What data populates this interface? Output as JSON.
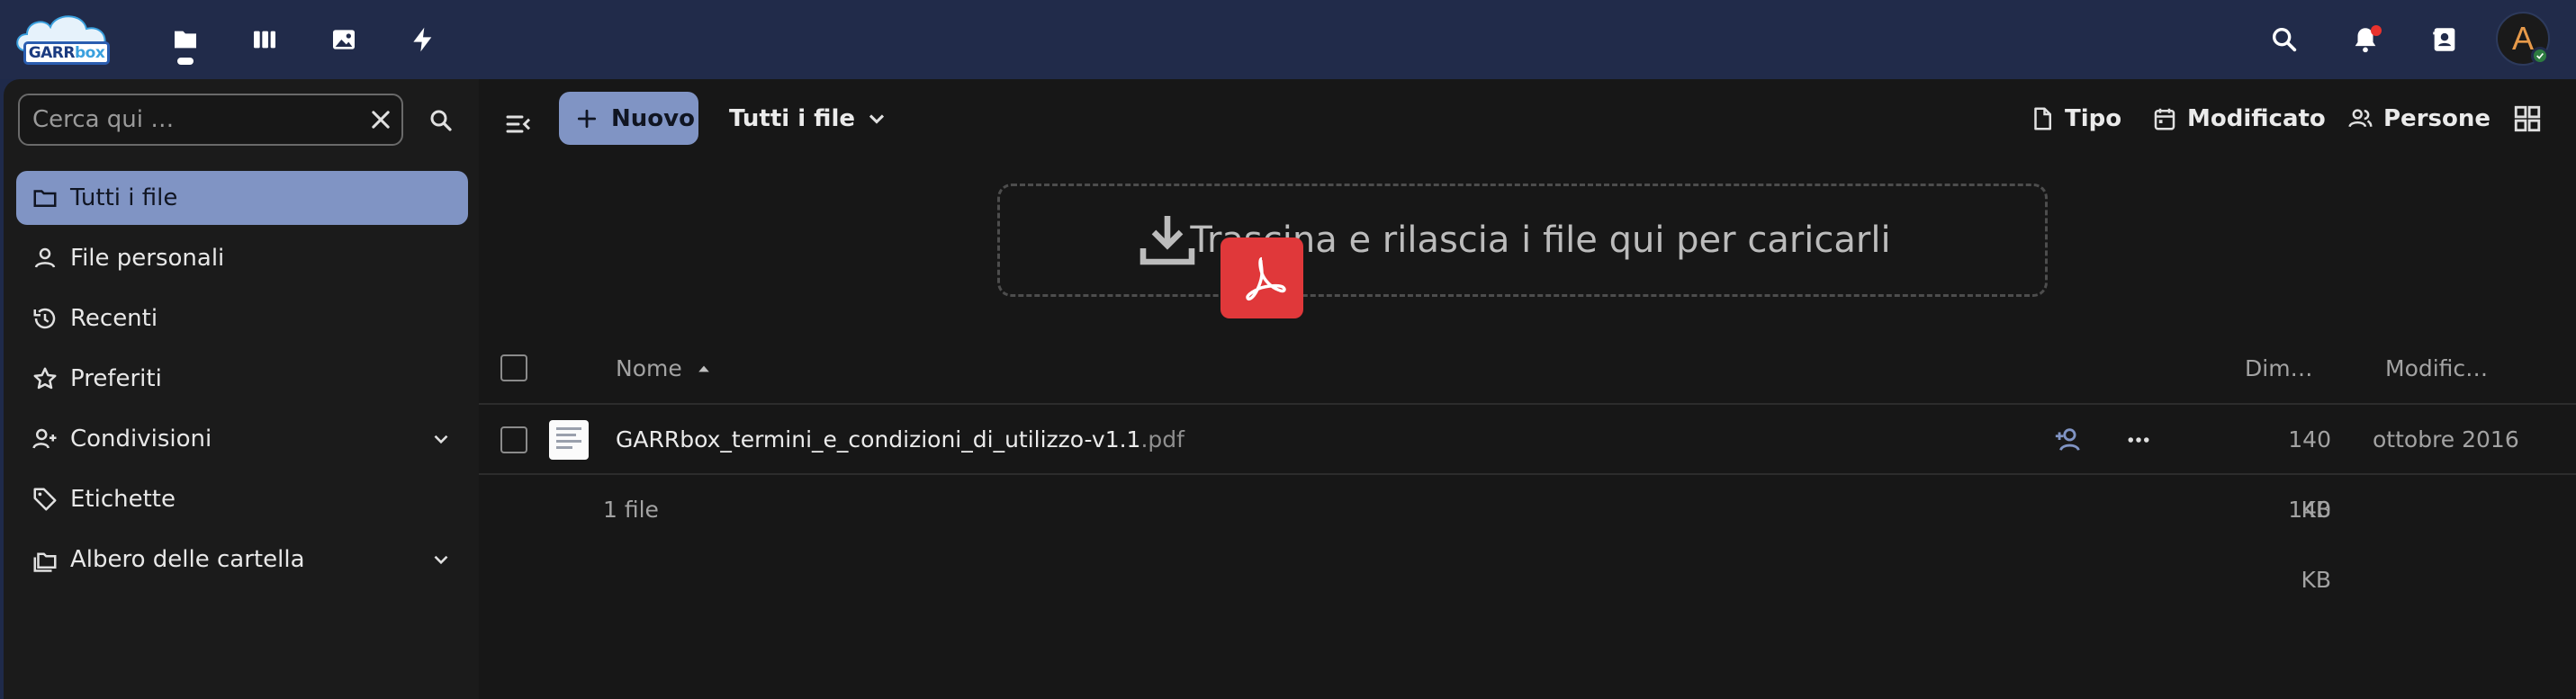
{
  "header": {
    "logo": {
      "text_main": "GARR",
      "text_accent": "box"
    },
    "apps": [
      {
        "name": "files-icon",
        "label": "Files"
      },
      {
        "name": "activity-icon",
        "label": "Activity"
      },
      {
        "name": "photos-icon",
        "label": "Photos"
      },
      {
        "name": "flash-icon",
        "label": "Flow"
      }
    ],
    "right": [
      {
        "name": "search-icon"
      },
      {
        "name": "notifications-icon"
      },
      {
        "name": "contacts-icon"
      }
    ],
    "avatar_initial": "A",
    "accent_color": "#8094c4",
    "header_bg": "#212b4a"
  },
  "sidebar": {
    "search": {
      "placeholder": "Cerca qui …",
      "value": ""
    },
    "items": [
      {
        "label": "Tutti i file",
        "icon": "folder-icon",
        "active": true
      },
      {
        "label": "File personali",
        "icon": "person-icon",
        "active": false
      },
      {
        "label": "Recenti",
        "icon": "history-icon",
        "active": false
      },
      {
        "label": "Preferiti",
        "icon": "star-icon",
        "active": false
      },
      {
        "label": "Condivisioni",
        "icon": "share-icon",
        "active": false,
        "expandable": true
      },
      {
        "label": "Etichette",
        "icon": "tag-icon",
        "active": false
      },
      {
        "label": "Albero delle cartella",
        "icon": "folder-tree-icon",
        "active": false,
        "expandable": true
      }
    ]
  },
  "toolbar": {
    "new_label": "Nuovo",
    "breadcrumb": "Tutti i file",
    "filters": [
      {
        "label": "Tipo",
        "icon": "file-type-icon"
      },
      {
        "label": "Modificato",
        "icon": "calendar-icon"
      },
      {
        "label": "Persone",
        "icon": "people-icon"
      }
    ]
  },
  "dropzone": {
    "text": "Trascina e rilascia i file qui per caricarli"
  },
  "table": {
    "columns": {
      "name": "Nome",
      "size": "Dim…",
      "modified": "Modific…"
    },
    "rows": [
      {
        "basename": "GARRbox_termini_e_condizioni_di_utilizzo-v1.1",
        "extension": ".pdf",
        "size": "140 KB",
        "modified": "ottobre 2016"
      }
    ],
    "summary": {
      "count": "1 file",
      "size": "140 KB"
    }
  }
}
